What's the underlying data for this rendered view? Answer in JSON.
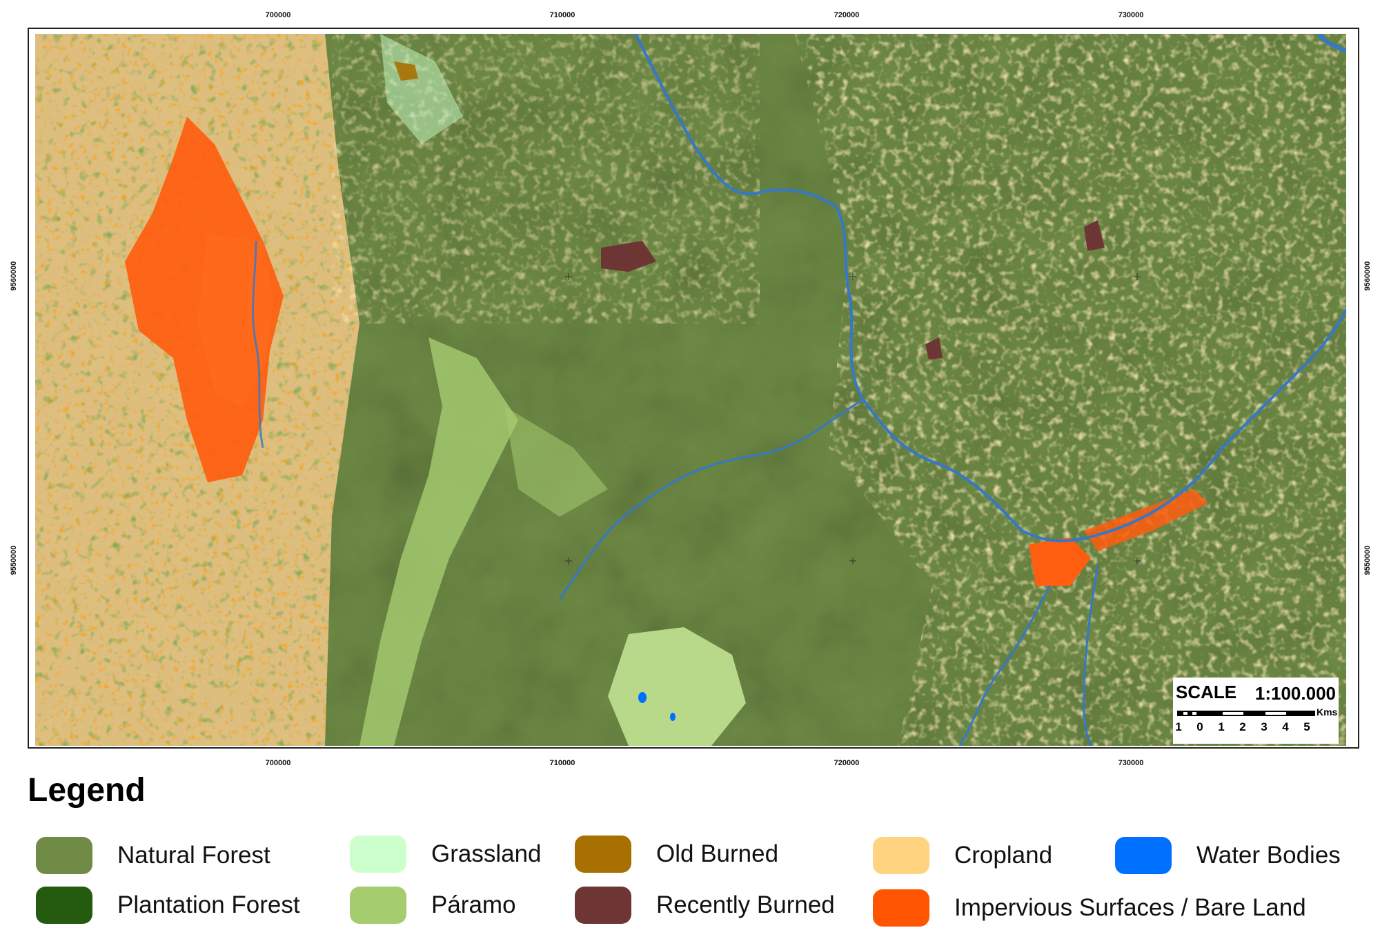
{
  "map": {
    "eastings": [
      "700000",
      "710000",
      "720000",
      "730000"
    ],
    "northings": [
      "9560000",
      "9550000"
    ]
  },
  "scale": {
    "label": "SCALE",
    "ratio": "1:100.000",
    "units": "Kms",
    "ticks": [
      "1",
      "0",
      "1",
      "2",
      "3",
      "4",
      "5"
    ]
  },
  "legend": {
    "title": "Legend",
    "items": [
      {
        "label": "Natural Forest",
        "color": "#6f8b46"
      },
      {
        "label": "Plantation Forest",
        "color": "#245b0f"
      },
      {
        "label": "Grassland",
        "color": "#ccffcc"
      },
      {
        "label": "Páramo",
        "color": "#a6cc70"
      },
      {
        "label": "Old Burned",
        "color": "#a87000"
      },
      {
        "label": "Recently Burned",
        "color": "#6e3535"
      },
      {
        "label": "Cropland",
        "color": "#ffd37f"
      },
      {
        "label": "Impervious Surfaces / Bare Land",
        "color": "#ff5500"
      },
      {
        "label": "Water Bodies",
        "color": "#0070ff"
      }
    ]
  }
}
